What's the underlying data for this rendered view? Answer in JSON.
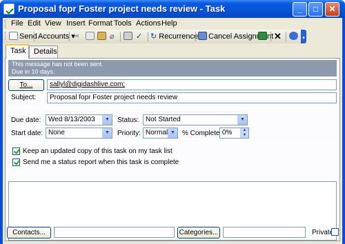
{
  "window": {
    "title": "Proposal fopr Foster project needs review - Task"
  },
  "menu": [
    {
      "label": "File"
    },
    {
      "label": "Edit"
    },
    {
      "label": "View"
    },
    {
      "label": "Insert"
    },
    {
      "label": "Format"
    },
    {
      "label": "Tools"
    },
    {
      "label": "Actions"
    },
    {
      "label": "Help"
    }
  ],
  "toolbar": {
    "send": "Send",
    "accounts": "Accounts",
    "recurrence": "Recurrence...",
    "cancel_assignment": "Cancel Assignment"
  },
  "tabs": [
    {
      "label": "Task"
    },
    {
      "label": "Details"
    }
  ],
  "info": {
    "line1": "This message has not been sent.",
    "line2": "Due in 10 days."
  },
  "to": {
    "button": "To...",
    "value": "sallyl@digidashlive.com;"
  },
  "subject": {
    "label": "Subject:",
    "value": "Proposal fopr Foster project needs review"
  },
  "due_date": {
    "label": "Due date:",
    "value": "Wed 8/13/2003"
  },
  "start_date": {
    "label": "Start date:",
    "value": "None"
  },
  "status": {
    "label": "Status:",
    "value": "Not Started"
  },
  "priority": {
    "label": "Priority:",
    "value": "Normal"
  },
  "complete": {
    "label": "% Complete:",
    "value": "0%"
  },
  "options": {
    "keep_copy": "Keep an updated copy of this task on my task list",
    "send_report": "Send me a status report when this task is complete"
  },
  "footer": {
    "contacts": "Contacts...",
    "categories": "Categories...",
    "private": "Private"
  },
  "colors": {
    "titlebar": "#0653d6",
    "face": "#ece9d8",
    "infobar": "#8d9aae"
  }
}
